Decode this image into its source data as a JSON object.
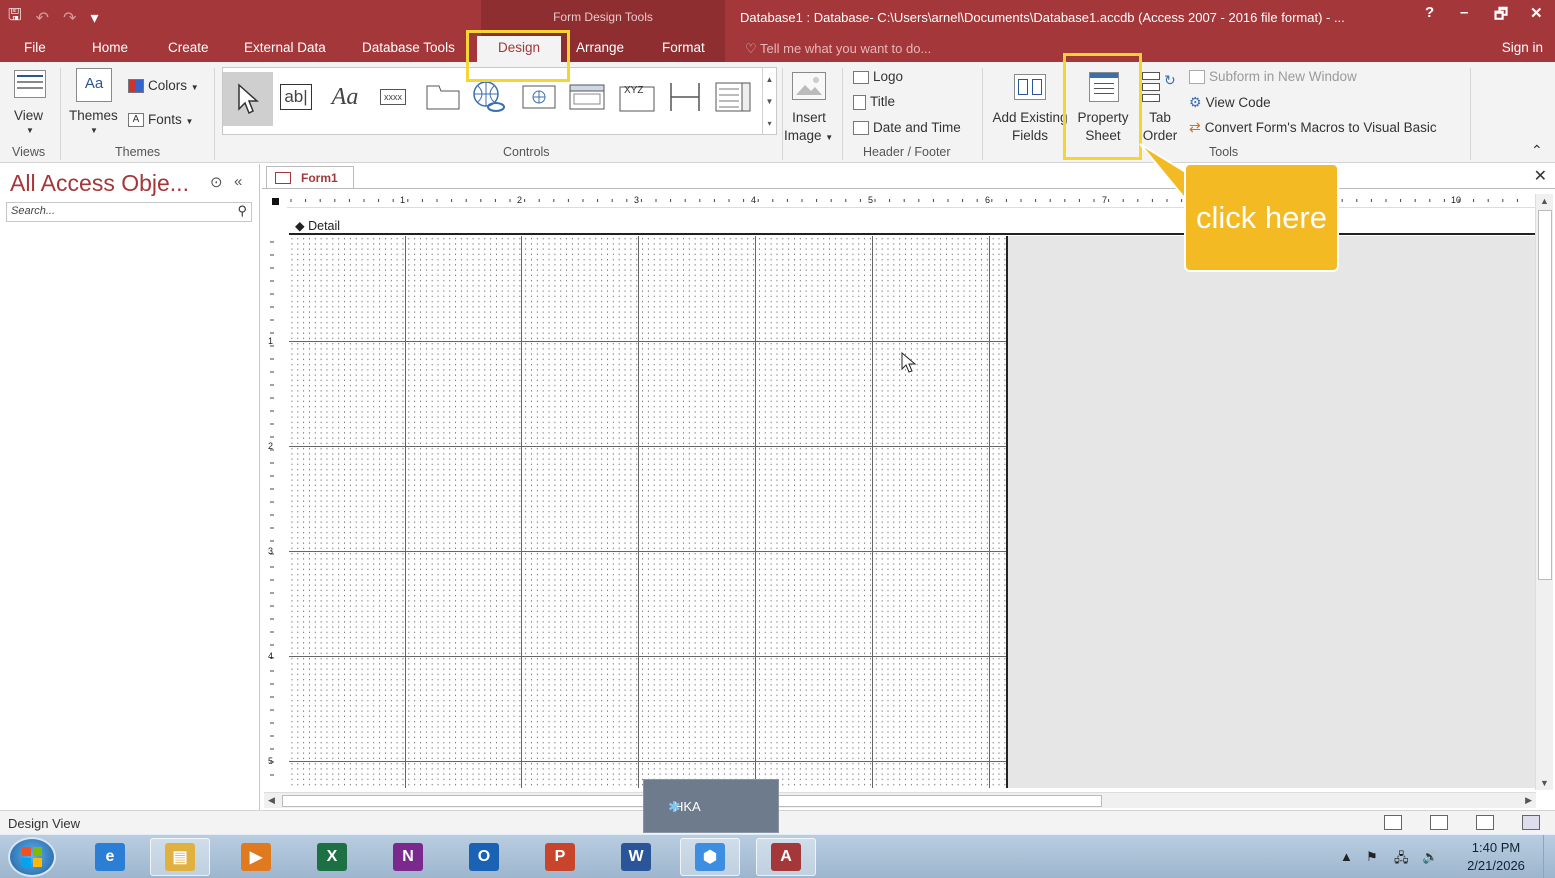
{
  "window": {
    "title": "Database1 : Database- C:\\Users\\arnel\\Documents\\Database1.accdb (Access 2007 - 2016 file format) - ...",
    "context_label": "Form Design Tools",
    "help": "?",
    "minimize": "–",
    "restore": "🗗",
    "close": "✕"
  },
  "qat": {
    "save": "🖫",
    "undo": "↶",
    "redo": "↷",
    "customize": "▾"
  },
  "tabs": {
    "file": "File",
    "home": "Home",
    "create": "Create",
    "external_data": "External Data",
    "database_tools": "Database Tools",
    "design": "Design",
    "arrange": "Arrange",
    "format": "Format",
    "tell_me": "Tell me what you want to do...",
    "sign_in": "Sign in"
  },
  "ribbon": {
    "view": "View",
    "themes": "Themes",
    "colors": "Colors",
    "fonts": "Fonts",
    "group_views": "Views",
    "group_themes": "Themes",
    "group_controls": "Controls",
    "group_header_footer": "Header / Footer",
    "group_tools": "Tools",
    "controls": {
      "textbox": "ab|",
      "label": "Aa",
      "button": "xxxx",
      "combo_xyz": "XYZ"
    },
    "insert_image": [
      "Insert",
      "Image"
    ],
    "logo": "Logo",
    "title": "Title",
    "date_time": "Date and Time",
    "add_existing_fields": [
      "Add Existing",
      "Fields"
    ],
    "property_sheet": [
      "Property",
      "Sheet"
    ],
    "tab_order": [
      "Tab",
      "Order"
    ],
    "subform_new_window": "Subform in New Window",
    "view_code": "View Code",
    "convert_macros": "Convert Form's Macros to Visual Basic",
    "collapse": "⌃"
  },
  "nav": {
    "title": "All Access Obje...",
    "search_placeholder": "Search...",
    "menu_icon": "⊙",
    "collapse_icon": "«",
    "search_icon": "⚲"
  },
  "document": {
    "tab_label": "Form1",
    "close": "✕",
    "section": "Detail",
    "ruler_numbers": [
      "1",
      "2",
      "3",
      "4",
      "5",
      "6",
      "7",
      "10"
    ],
    "left_ruler_numbers": [
      "1",
      "2",
      "3",
      "4",
      "5"
    ]
  },
  "callout": {
    "text": "click here",
    "color": "#f4ba24"
  },
  "popup": {
    "label": "HKA"
  },
  "status": {
    "text": "Design View"
  },
  "taskbar": {
    "apps": [
      {
        "name": "ie",
        "glyph": "e",
        "color": "#2a7fd4"
      },
      {
        "name": "explorer",
        "glyph": "▤",
        "color": "#e0b040"
      },
      {
        "name": "media",
        "glyph": "▶",
        "color": "#e07a1f"
      },
      {
        "name": "excel",
        "glyph": "X",
        "color": "#1d7044"
      },
      {
        "name": "onenote",
        "glyph": "N",
        "color": "#7a2a8c"
      },
      {
        "name": "outlook",
        "glyph": "O",
        "color": "#1a62b3"
      },
      {
        "name": "powerpoint",
        "glyph": "P",
        "color": "#c8452b"
      },
      {
        "name": "word",
        "glyph": "W",
        "color": "#2a5699"
      },
      {
        "name": "virtualbox",
        "glyph": "⬢",
        "color": "#3d8ee0"
      },
      {
        "name": "access",
        "glyph": "A",
        "color": "#a4373a"
      }
    ],
    "time": "1:40 PM",
    "date": "2/21/2026"
  },
  "colors": {
    "accent": "#a4373a",
    "highlight": "#f5d532"
  }
}
